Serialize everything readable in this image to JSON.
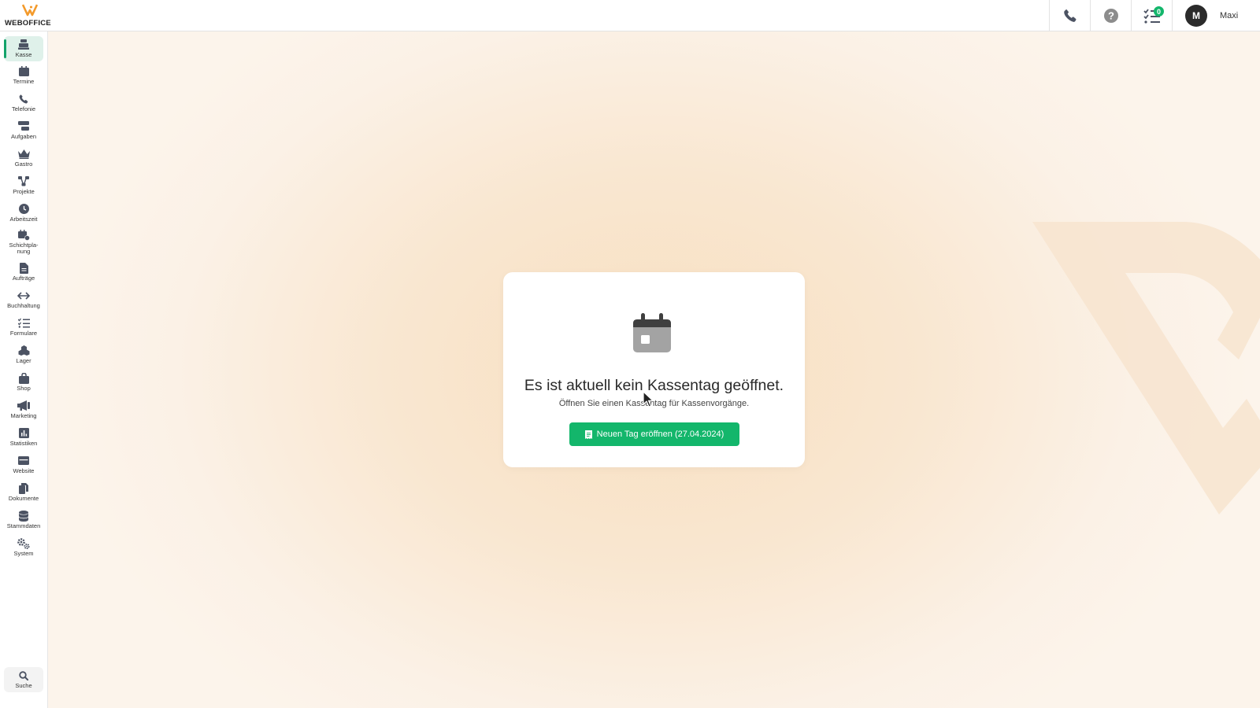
{
  "brand": {
    "logo_text": "WEBOFFICE",
    "accent": "#f39a2b"
  },
  "header": {
    "actions": [
      {
        "name": "phone",
        "icon": "phone-icon"
      },
      {
        "name": "help",
        "icon": "help-icon"
      },
      {
        "name": "tasks",
        "icon": "task-list-icon",
        "badge": "0"
      }
    ],
    "user": {
      "initial": "M",
      "name": "Maxi"
    }
  },
  "sidebar": {
    "items": [
      {
        "label": "Kasse",
        "icon": "cash-register-icon",
        "active": true
      },
      {
        "label": "Termine",
        "icon": "calendar-icon"
      },
      {
        "label": "Telefonie",
        "icon": "phone-icon"
      },
      {
        "label": "Aufgaben",
        "icon": "tasks-icon"
      },
      {
        "label": "Gastro",
        "icon": "crown-icon"
      },
      {
        "label": "Projekte",
        "icon": "project-icon"
      },
      {
        "label": "Arbeitszeit",
        "icon": "clock-icon"
      },
      {
        "label": "Schichtpla-\nnung",
        "icon": "shift-plan-icon"
      },
      {
        "label": "Aufträge",
        "icon": "document-icon"
      },
      {
        "label": "Buchhaltung",
        "icon": "arrows-icon"
      },
      {
        "label": "Formulare",
        "icon": "list-icon"
      },
      {
        "label": "Lager",
        "icon": "boxes-icon"
      },
      {
        "label": "Shop",
        "icon": "bag-icon"
      },
      {
        "label": "Marketing",
        "icon": "megaphone-icon"
      },
      {
        "label": "Statistiken",
        "icon": "chart-icon"
      },
      {
        "label": "Website",
        "icon": "window-icon"
      },
      {
        "label": "Dokumente",
        "icon": "copy-icon"
      },
      {
        "label": "Stammdaten",
        "icon": "database-icon"
      },
      {
        "label": "System",
        "icon": "gears-icon"
      }
    ],
    "search": {
      "label": "Suche",
      "icon": "search-icon"
    }
  },
  "main": {
    "card": {
      "icon": "calendar-icon",
      "title": "Es ist aktuell kein Kassentag geöffnet.",
      "subtitle": "Öffnen Sie einen Kassentag für Kassenvorgänge.",
      "button_label": "Neuen Tag eröffnen (27.04.2024)",
      "button_color": "#13b66b"
    }
  }
}
